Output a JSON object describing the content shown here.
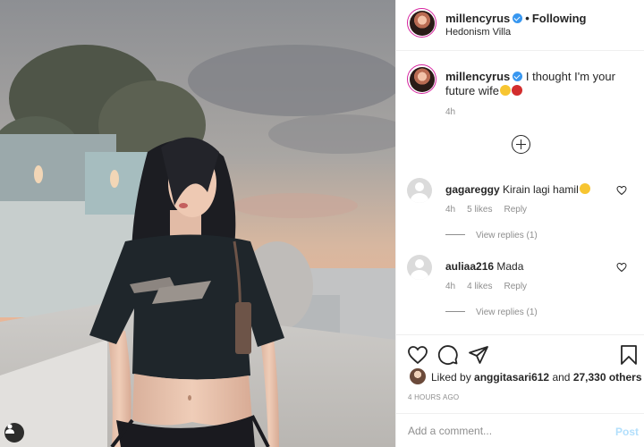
{
  "post": {
    "username": "millencyrus",
    "follow_label": "Following",
    "location": "Hedonism Villa",
    "photo_description_icon": "person-tag-icon"
  },
  "caption": {
    "username": "millencyrus",
    "text": "I thought I'm your future wife",
    "time": "4h"
  },
  "comments": [
    {
      "username": "gagareggy",
      "text": "Kirain lagi hamil",
      "time": "4h",
      "likes": "5 likes",
      "reply": "Reply",
      "view_replies": "View replies (1)"
    },
    {
      "username": "auliaa216",
      "text": "Mada",
      "time": "4h",
      "likes": "4 likes",
      "reply": "Reply",
      "view_replies": "View replies (1)"
    }
  ],
  "likes": {
    "liked_by_prefix": "Liked by",
    "liked_by_user": "anggitasari612",
    "and": "and",
    "others": "27,330 others"
  },
  "post_age": "4 HOURS AGO",
  "add_comment": {
    "placeholder": "Add a comment...",
    "post_label": "Post"
  },
  "colors": {
    "verified": "#3897f0",
    "muted": "#8e8e8e",
    "post_disabled": "#b2dffc",
    "text": "#262626"
  }
}
